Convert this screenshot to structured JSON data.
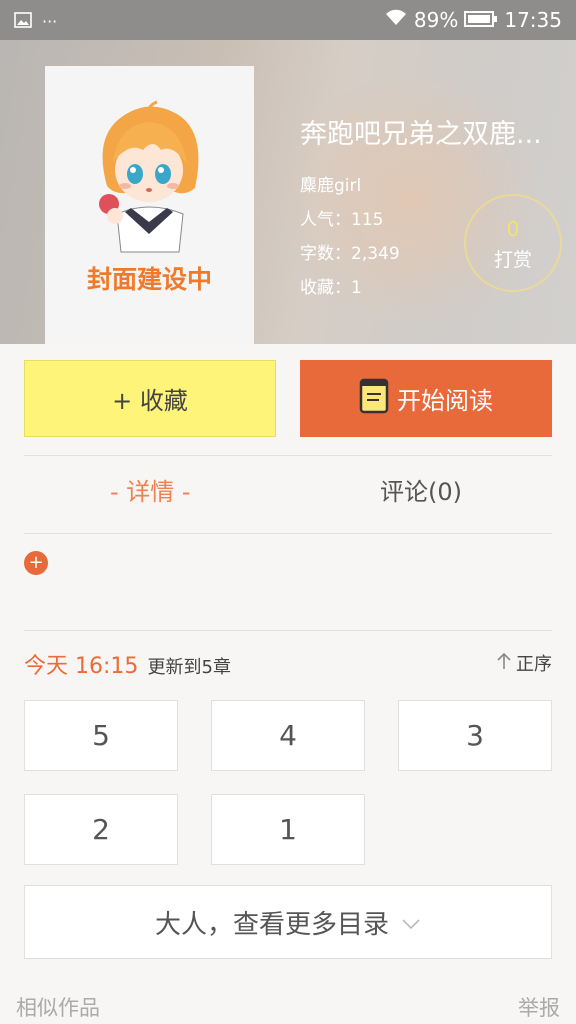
{
  "status_bar": {
    "battery": "89%",
    "time": "17:35"
  },
  "book": {
    "cover_caption": "封面建设中",
    "title": "奔跑吧兄弟之双鹿...",
    "author": "麋鹿girl",
    "popularity": "人气：115",
    "word_count": "字数：2,349",
    "favorites": "收藏：1"
  },
  "reward": {
    "count": "0",
    "label": "打赏"
  },
  "actions": {
    "collect": "+ 收藏",
    "read": "开始阅读"
  },
  "tabs": {
    "detail": "- 详情 -",
    "comments": "评论(0)"
  },
  "update": {
    "time": "今天 16:15",
    "text": "更新到5章",
    "sort_label": "正序"
  },
  "chapters": [
    "5",
    "4",
    "3",
    "2",
    "1"
  ],
  "more_catalog": "大人，查看更多目录",
  "footer": {
    "similar": "相似作品",
    "report": "举报"
  },
  "colors": {
    "accent": "#e8693a",
    "collect_bg": "#fef47a",
    "tab_active": "#ee8150"
  }
}
